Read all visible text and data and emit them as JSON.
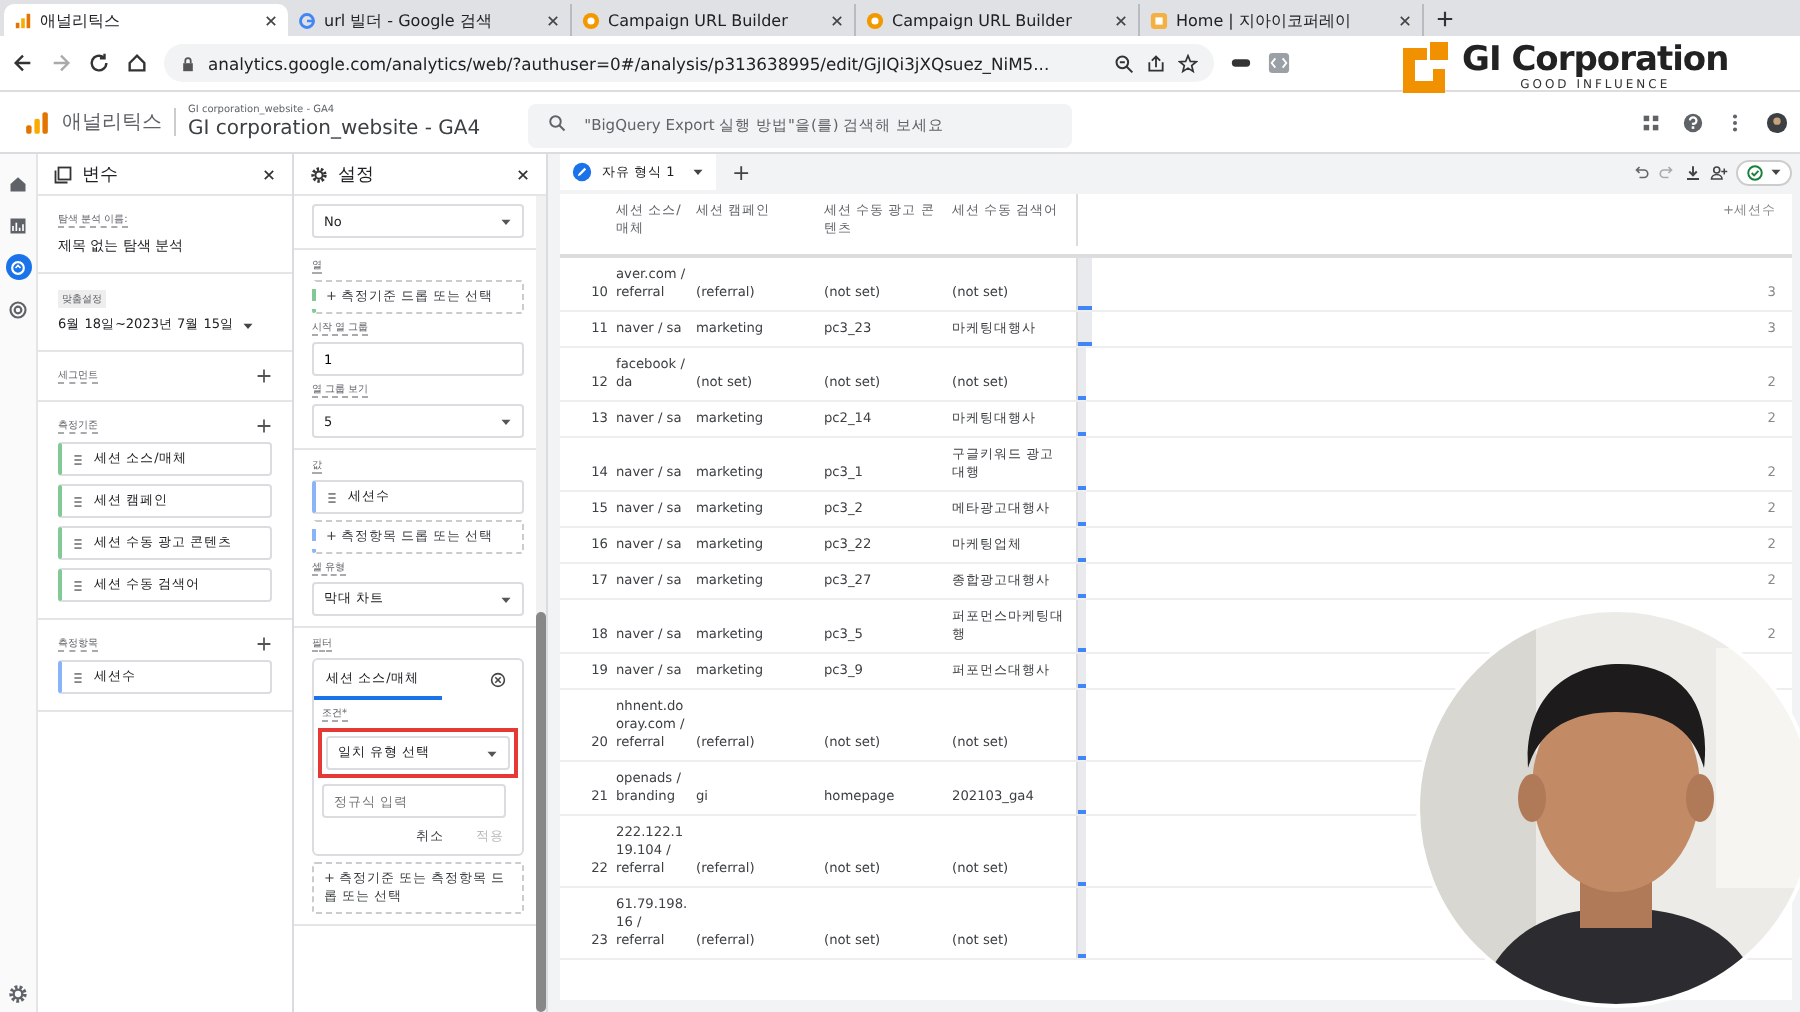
{
  "browser_tabs": [
    {
      "label": "애널리틱스",
      "selected": true
    },
    {
      "label": "url 빌더 - Google 검색",
      "selected": false
    },
    {
      "label": "Campaign URL Builder",
      "selected": false
    },
    {
      "label": "Campaign URL Builder",
      "selected": false
    },
    {
      "label": "Home | 지아이코퍼레이",
      "selected": false
    }
  ],
  "address_bar": {
    "url": "analytics.google.com/analytics/web/?authuser=0#/analysis/p313638995/edit/GjIQi3jXQsuez_NiM5..."
  },
  "logo_overlay": {
    "name": "GI Corporation",
    "tagline": "GOOD INFLUENCE"
  },
  "app_header": {
    "product": "애널리틱스",
    "account_path": "GI corporation_website - GA4",
    "property": "GI corporation_website - GA4",
    "search": {
      "placeholder": "\"BigQuery Export 실행 방법\"을(를) 검색해 보세요"
    }
  },
  "nav_rail": [
    {
      "selected": false
    },
    {
      "selected": false
    },
    {
      "selected": true
    },
    {
      "selected": false
    }
  ],
  "variables_panel": {
    "title": "변수",
    "name_label": "탐색 분석 이름:",
    "name": "제목 없는 탐색 분석",
    "date_chip": "맞춤설정",
    "date_range": "6월 18일~2023년 7월 15일",
    "sections": [
      {
        "title": "세그먼트"
      },
      {
        "title": "측정기준",
        "kind": "dimension",
        "items": [
          "세션 소스/매체",
          "세션 캠페인",
          "세션 수동 광고 콘텐츠",
          "세션 수동 검색어"
        ]
      },
      {
        "title": "측정항목",
        "kind": "metric",
        "items": [
          "세션수"
        ]
      }
    ]
  },
  "settings_panel": {
    "title": "설정",
    "top_select": "No",
    "columns_label": "열",
    "columns_drop": "+ 측정기준 드롭 또는 선택",
    "start_group_label": "시작 열 그룹",
    "start_group": "1",
    "show_groups_label": "열 그룹 보기",
    "show_groups": "5",
    "values_label": "값",
    "value_chip": "세션수",
    "values_drop": "+ 측정항목 드롭 또는 선택",
    "cell_type_label": "셀 유형",
    "cell_type": "막대 차트",
    "filter": {
      "label": "필터",
      "dimension": "세션 소스/매체",
      "condition_label": "조건*",
      "match_select": "일치 유형 선택",
      "highlighted": true,
      "regex": {
        "placeholder": "정규식 입력"
      },
      "cancel": "취소",
      "apply": "적용",
      "apply_disabled": true
    },
    "filters_drop": "+ 측정기준 또는 측정항목 드롭 또는 선택"
  },
  "report_tabs": [
    {
      "label": "자유 형식 1",
      "selected": true
    }
  ],
  "add_tab": "+",
  "table": {
    "columns": [
      "세션 소스/매체",
      "세션 캠페인",
      "세션 수동 광고 콘텐츠",
      "세션 수동 검색어",
      "+세션수"
    ],
    "rows": [
      {
        "index": "10",
        "source": "aver.com / referral",
        "campaign": "(referral)",
        "content": "(not set)",
        "keyword": "(not set)",
        "level": 0.2,
        "sessions": "3"
      },
      {
        "index": "11",
        "source": "naver / sa",
        "campaign": "marketing",
        "content": "pc3_23",
        "keyword": "마케팅대행사",
        "level": 0.2,
        "sessions": "3"
      },
      {
        "index": "12",
        "source": "facebook / da",
        "campaign": "(not set)",
        "content": "(not set)",
        "keyword": "(not set)",
        "level": 0.12,
        "sessions": "2"
      },
      {
        "index": "13",
        "source": "naver / sa",
        "campaign": "marketing",
        "content": "pc2_14",
        "keyword": "마케팅대행사",
        "level": 0.12,
        "sessions": "2"
      },
      {
        "index": "14",
        "source": "naver / sa",
        "campaign": "marketing",
        "content": "pc3_1",
        "keyword": "구글키워드 광고대행",
        "level": 0.12,
        "sessions": "2"
      },
      {
        "index": "15",
        "source": "naver / sa",
        "campaign": "marketing",
        "content": "pc3_2",
        "keyword": "메타광고대행사",
        "level": 0.12,
        "sessions": "2"
      },
      {
        "index": "16",
        "source": "naver / sa",
        "campaign": "marketing",
        "content": "pc3_22",
        "keyword": "마케팅업체",
        "level": 0.12,
        "sessions": "2"
      },
      {
        "index": "17",
        "source": "naver / sa",
        "campaign": "marketing",
        "content": "pc3_27",
        "keyword": "종합광고대행사",
        "level": 0.12,
        "sessions": "2"
      },
      {
        "index": "18",
        "source": "naver / sa",
        "campaign": "marketing",
        "content": "pc3_5",
        "keyword": "퍼포먼스마케팅대행",
        "level": 0.12,
        "sessions": "2"
      },
      {
        "index": "19",
        "source": "naver / sa",
        "campaign": "marketing",
        "content": "pc3_9",
        "keyword": "퍼포먼스대행사",
        "level": 0.12
      },
      {
        "index": "20",
        "source": "nhnent.dooray.com / referral",
        "campaign": "(referral)",
        "content": "(not set)",
        "keyword": "(not set)",
        "level": 0.12
      },
      {
        "index": "21",
        "source": "openads / branding",
        "campaign": "gi",
        "content": "homepage",
        "keyword": "202103_ga4",
        "level": 0.12
      },
      {
        "index": "22",
        "source": "222.122.119.104 / referral",
        "campaign": "(referral)",
        "content": "(not set)",
        "keyword": "(not set)",
        "level": 0.12
      },
      {
        "index": "23",
        "source": "61.79.198.16 / referral",
        "campaign": "(referral)",
        "content": "(not set)",
        "keyword": "(not set)",
        "level": 0.12
      }
    ]
  }
}
